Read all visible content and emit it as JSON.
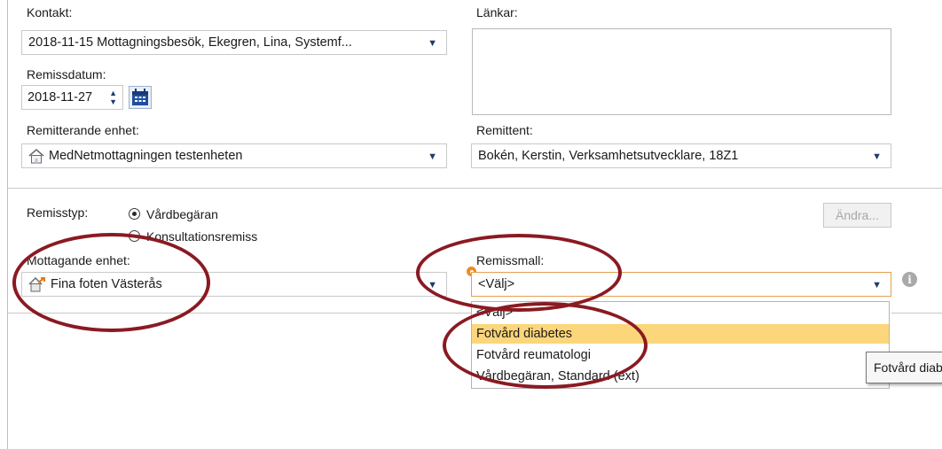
{
  "form": {
    "kontakt_label": "Kontakt:",
    "kontakt_value": "2018-11-15 Mottagningsbesök, Ekegren, Lina, Systemf...",
    "lankar_label": "Länkar:",
    "remissdatum_label": "Remissdatum:",
    "remissdatum_value": "2018-11-27",
    "remitterande_label": "Remitterande enhet:",
    "remitterande_value": "MedNetmottagningen testenheten",
    "remittent_label": "Remittent:",
    "remittent_value": "Bokén, Kerstin, Verksamhetsutvecklare, 18Z1",
    "remisstyp_label": "Remisstyp:",
    "remisstyp_options": [
      "Vårdbegäran",
      "Konsultationsremiss"
    ],
    "remisstyp_selected": "Vårdbegäran",
    "andra_button": "Ändra...",
    "mottagande_label": "Mottagande enhet:",
    "mottagande_value": "Fina foten Västerås",
    "remissmall_label": "Remissmall:",
    "remissmall_value": "<Välj>",
    "remissmall_options": [
      "<Välj>",
      "Fotvård diabetes",
      "Fotvård reumatologi",
      "Vårdbegäran, Standard (ext)"
    ],
    "remissmall_highlighted": "Fotvård diabetes",
    "tooltip_text": "Fotvård diabetes"
  },
  "icons": {
    "dropdown_arrow": "triangle-down-icon",
    "calendar": "calendar-icon",
    "spinner": "spinner-icon",
    "house": "house-icon",
    "house_arrow": "house-arrow-icon",
    "info": "info-icon",
    "required": "required-dot-icon"
  },
  "colors": {
    "annotation_circle": "#8a1a22",
    "highlight": "#fbd67a",
    "required_dot": "#f08a1c",
    "icon_blue": "#1f3a6e"
  }
}
